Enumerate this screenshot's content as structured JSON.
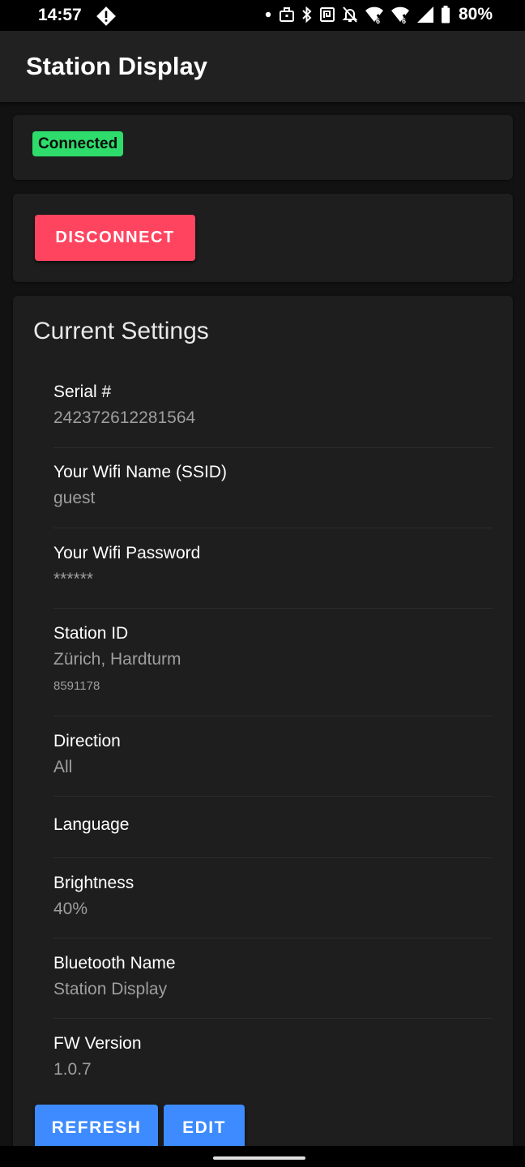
{
  "status_bar": {
    "time": "14:57",
    "battery_percent": "80%",
    "icons": [
      "alert-icon",
      "dot-icon",
      "work-profile-icon",
      "bluetooth-icon",
      "nfc-icon",
      "mute-icon",
      "wifi-icon",
      "wifi-icon",
      "signal-icon",
      "battery-icon"
    ]
  },
  "app_bar": {
    "title": "Station Display"
  },
  "connection": {
    "status": "Connected",
    "status_color": "#2ddc6a"
  },
  "actions": {
    "disconnect_label": "DISCONNECT",
    "disconnect_color": "#ff4460"
  },
  "settings": {
    "title": "Current Settings",
    "items": [
      {
        "label": "Serial #",
        "value": "242372612281564"
      },
      {
        "label": "Your Wifi Name (SSID)",
        "value": "guest"
      },
      {
        "label": "Your Wifi Password",
        "value": "******"
      },
      {
        "label": "Station ID",
        "value": "Zürich, Hardturm",
        "sub": "8591178"
      },
      {
        "label": "Direction",
        "value": "All"
      },
      {
        "label": "Language",
        "value": ""
      },
      {
        "label": "Brightness",
        "value": "40%"
      },
      {
        "label": "Bluetooth Name",
        "value": "Station Display"
      },
      {
        "label": "FW Version",
        "value": "1.0.7"
      }
    ],
    "refresh_label": "REFRESH",
    "edit_label": "EDIT",
    "button_color": "#3d8bff"
  }
}
